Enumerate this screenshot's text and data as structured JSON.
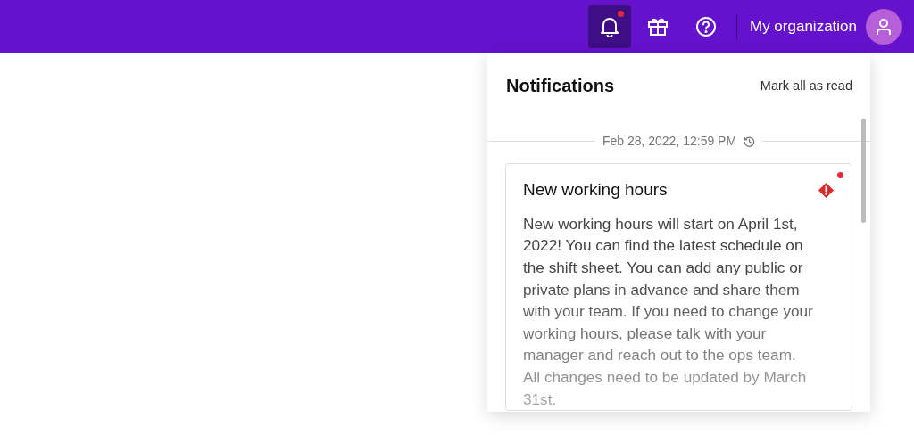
{
  "topbar": {
    "icons": [
      {
        "kind": "bell",
        "selected": true,
        "unread": true
      },
      {
        "kind": "gift",
        "selected": false,
        "unread": false
      },
      {
        "kind": "help",
        "selected": false,
        "unread": false
      }
    ],
    "organization": "My organization"
  },
  "notifications": {
    "title": "Notifications",
    "mark_all": "Mark all as read",
    "groups": [
      {
        "timestamp": "Feb 28, 2022, 12:59 PM",
        "items": [
          {
            "title": "New working hours",
            "unread": true,
            "kind": "alert",
            "body": "New working hours will start on April 1st, 2022! You can find the latest schedule on the shift sheet. You can add any public or private plans in advance and share them with your team. If you need to change your working hours, please talk with your manager and reach out to the ops team. All changes need to be updated by March 31st."
          }
        ]
      }
    ]
  }
}
